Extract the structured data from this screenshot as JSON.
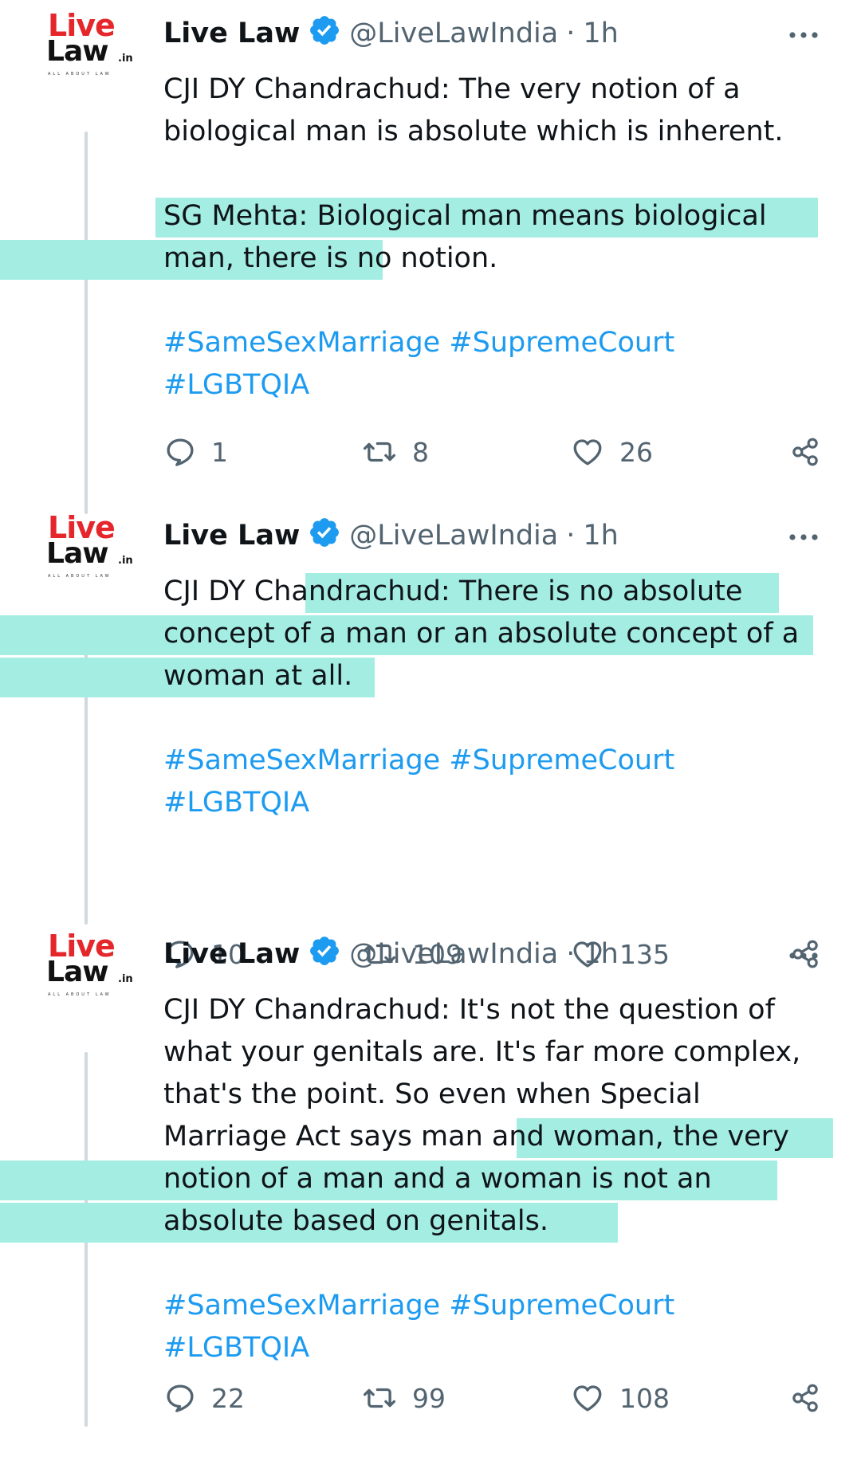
{
  "tweets": [
    {
      "author": "Live Law",
      "handle": "@LiveLawIndia",
      "sep": "·",
      "time": "1h",
      "logo": {
        "live": "Live",
        "law": "Law",
        "in": ".in",
        "tagline": "ALL ABOUT LAW"
      },
      "lines": [
        [
          {
            "t": "CJI DY Chandrachud: The very notion of a",
            "h": false
          }
        ],
        [
          {
            "t": "biological man is absolute which is inherent.",
            "h": false
          }
        ],
        [],
        [
          {
            "t": "SG Mehta: ",
            "h": false
          },
          {
            "t": "Biological man means biological",
            "h": true
          }
        ],
        [
          {
            "t": "man, there is no notion.",
            "h": true
          }
        ],
        [],
        [
          {
            "t": "#SameSexMarriage #SupremeCourt",
            "h": false,
            "tag": true
          }
        ],
        [
          {
            "t": "#LGBTQIA",
            "h": false,
            "tag": true
          }
        ]
      ],
      "replies": "1",
      "reposts": "8",
      "likes": "26"
    },
    {
      "author": "Live Law",
      "handle": "@LiveLawIndia",
      "sep": "·",
      "time": "1h",
      "logo": {
        "live": "Live",
        "law": "Law",
        "in": ".in",
        "tagline": "ALL ABOUT LAW"
      },
      "lines": [
        [
          {
            "t": "CJI DY Chandrachud: ",
            "h": false
          },
          {
            "t": "There is no absolute",
            "h": true
          }
        ],
        [
          {
            "t": "concept of a man or an absolute concept of a",
            "h": true
          }
        ],
        [
          {
            "t": "woman at all.",
            "h": true
          }
        ],
        [],
        [
          {
            "t": "#SameSexMarriage #SupremeCourt",
            "h": false,
            "tag": true
          }
        ],
        [
          {
            "t": "#LGBTQIA",
            "h": false,
            "tag": true
          }
        ]
      ],
      "replies": "10",
      "reposts": "109",
      "likes": "135"
    },
    {
      "author": "Live Law",
      "handle": "@LiveLawIndia",
      "sep": "·",
      "time": "1h",
      "logo": {
        "live": "Live",
        "law": "Law",
        "in": ".in",
        "tagline": "ALL ABOUT LAW"
      },
      "lines": [
        [
          {
            "t": "CJI DY Chandrachud: It's not the question of",
            "h": false
          }
        ],
        [
          {
            "t": "what your genitals are. It's far more complex,",
            "h": false
          }
        ],
        [
          {
            "t": "that's the point. So even when Special",
            "h": false
          }
        ],
        [
          {
            "t": "Marriage Act says man and woman, ",
            "h": false
          },
          {
            "t": "the very",
            "h": true
          }
        ],
        [
          {
            "t": "notion of a man and a woman is not an",
            "h": true
          }
        ],
        [
          {
            "t": "absolute based on genitals.",
            "h": true
          }
        ],
        [],
        [
          {
            "t": "#SameSexMarriage #SupremeCourt",
            "h": false,
            "tag": true
          }
        ],
        [
          {
            "t": "#LGBTQIA",
            "h": false,
            "tag": true
          }
        ]
      ],
      "replies": "22",
      "reposts": "99",
      "likes": "108"
    }
  ],
  "colors": {
    "highlight": "#a4ede2",
    "link": "#1d9bf0",
    "verified": "#1d9bf0",
    "muted": "#536471",
    "logo_red": "#e5262b"
  },
  "icons": [
    "verified-badge-icon",
    "more-icon",
    "reply-icon",
    "repost-icon",
    "like-icon",
    "share-icon"
  ]
}
